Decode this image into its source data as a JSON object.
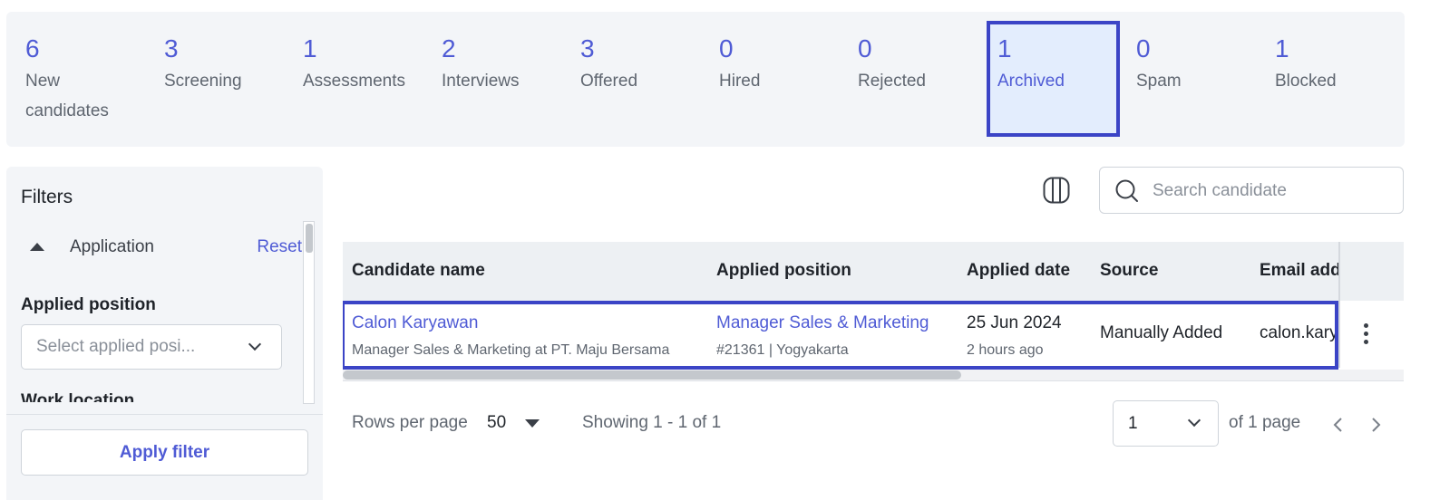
{
  "stages": [
    {
      "count": "6",
      "label": "New candidates",
      "active": false
    },
    {
      "count": "3",
      "label": "Screening",
      "active": false
    },
    {
      "count": "1",
      "label": "Assessments",
      "active": false
    },
    {
      "count": "2",
      "label": "Interviews",
      "active": false
    },
    {
      "count": "3",
      "label": "Offered",
      "active": false
    },
    {
      "count": "0",
      "label": "Hired",
      "active": false
    },
    {
      "count": "0",
      "label": "Rejected",
      "active": false
    },
    {
      "count": "1",
      "label": "Archived",
      "active": true
    },
    {
      "count": "0",
      "label": "Spam",
      "active": false
    },
    {
      "count": "1",
      "label": "Blocked",
      "active": false
    }
  ],
  "filters": {
    "title": "Filters",
    "section_label": "Application",
    "reset_label": "Reset",
    "applied_position_label": "Applied position",
    "applied_position_placeholder": "Select applied posi...",
    "work_location_label": "Work location",
    "apply_label": "Apply filter"
  },
  "toolbar": {
    "search_placeholder": "Search candidate"
  },
  "table": {
    "headers": [
      "Candidate name",
      "Applied position",
      "Applied date",
      "Source",
      "Email add"
    ],
    "rows": [
      {
        "name": "Calon Karyawan",
        "name_sub": "Manager Sales & Marketing at PT. Maju Bersama",
        "position": "Manager Sales & Marketing",
        "position_sub": "#21361 | Yogyakarta",
        "date": "25 Jun 2024",
        "date_sub": "2 hours ago",
        "source": "Manually Added",
        "email": "calon.kary"
      }
    ]
  },
  "pagination": {
    "rows_per_page_label": "Rows per page",
    "rows_per_page_value": "50",
    "showing": "Showing 1 - 1 of 1",
    "current_page": "1",
    "of_pages": "of 1 page"
  },
  "colors": {
    "accent": "#4f5bd5",
    "highlight_border": "#3b44c6",
    "active_stage_bg": "#e3edfd"
  }
}
